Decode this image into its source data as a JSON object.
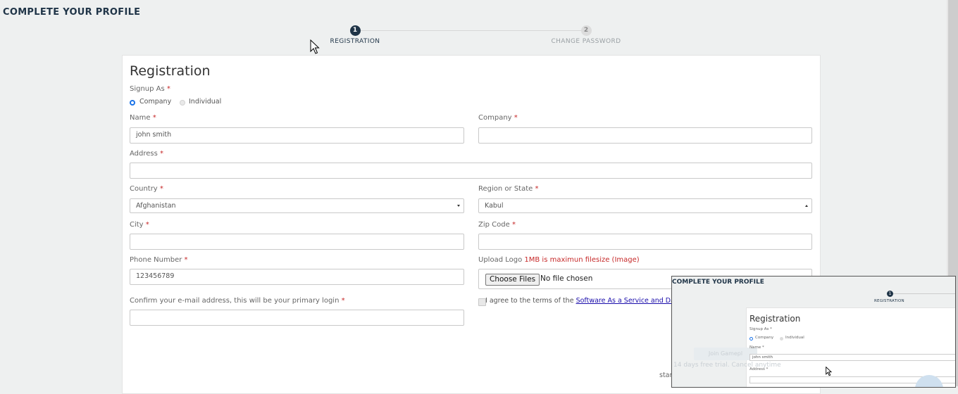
{
  "page": {
    "title": "COMPLETE YOUR PROFILE"
  },
  "steps": [
    {
      "number": "1",
      "label": "REGISTRATION",
      "active": true
    },
    {
      "number": "2",
      "label": "CHANGE PASSWORD",
      "active": false
    }
  ],
  "form": {
    "title": "Registration",
    "required_mark": "*",
    "signup_as": {
      "label": "Signup As",
      "options": [
        "Company",
        "Individual"
      ],
      "selected": "Company"
    },
    "name": {
      "label": "Name",
      "value": "john smith"
    },
    "company": {
      "label": "Company",
      "value": ""
    },
    "address": {
      "label": "Address",
      "value": ""
    },
    "country": {
      "label": "Country",
      "value": "Afghanistan"
    },
    "region": {
      "label": "Region or State",
      "value": "Kabul"
    },
    "city": {
      "label": "City",
      "value": ""
    },
    "zip": {
      "label": "Zip Code",
      "value": ""
    },
    "phone": {
      "label": "Phone Number",
      "value": "123456789"
    },
    "logo": {
      "label": "Upload Logo",
      "hint": "1MB is maximun filesize (Image)",
      "button": "Choose Files",
      "status": "No file chosen"
    },
    "email_confirm": {
      "label": "Confirm your e-mail address, this will be your primary login",
      "value": ""
    },
    "terms": {
      "prefix": "I agree to the terms of the",
      "link": "Software As a Service and Dat"
    },
    "faded_button": "Join Gamepl",
    "faded_trial": "14 days free trial. Cancel anytime",
    "faded_start_prefix": "start"
  },
  "overlay": {
    "title": "COMPLETE YOUR PROFILE",
    "step_number": "1",
    "step_label": "REGISTRATION",
    "form_title": "Registration",
    "signup_label": "Signup As *",
    "opt_company": "Company",
    "opt_individual": "Individual",
    "name_label": "Name *",
    "name_value": "john smith",
    "address_label": "Address *"
  },
  "colors": {
    "primary": "#1f3447",
    "required": "#c62828",
    "link": "#1a0dab",
    "radio": "#1a73e8"
  },
  "icons": [
    "mouse-cursor-icon",
    "dropdown-caret-icon"
  ]
}
